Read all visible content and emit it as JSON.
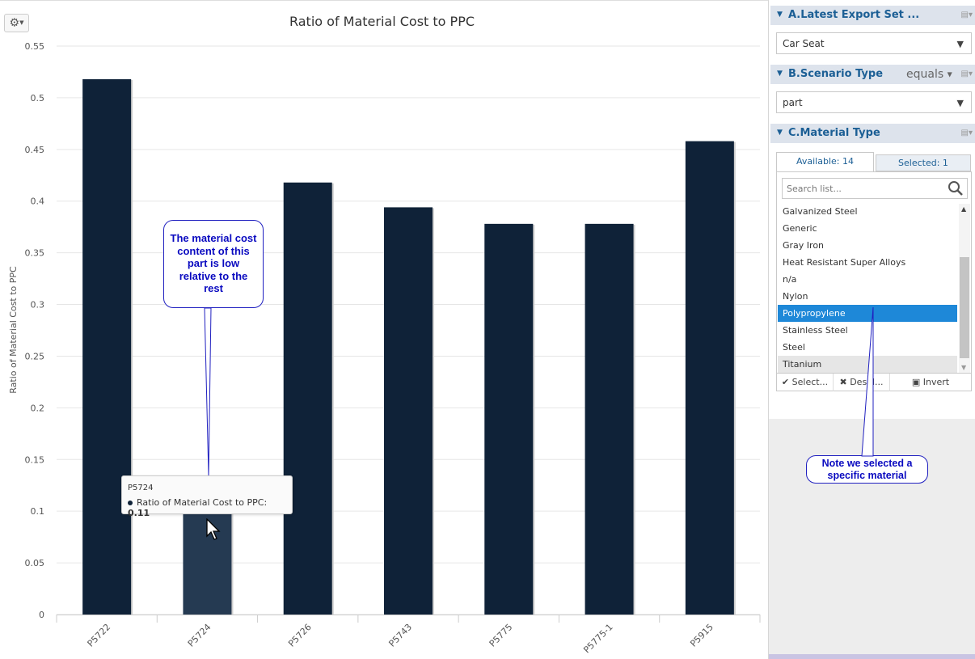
{
  "toolbar": {
    "gear_icon": "gear-icon"
  },
  "chart_data": {
    "type": "bar",
    "title": "Ratio of Material Cost to PPC",
    "ylabel": "Ratio of Material Cost to PPC",
    "xlabel": "",
    "categories": [
      "P5722",
      "P5724",
      "P5726",
      "P5743",
      "P5775",
      "P5775-1",
      "P5915"
    ],
    "values": [
      0.518,
      0.11,
      0.418,
      0.394,
      0.378,
      0.378,
      0.458
    ],
    "ylim": [
      0,
      0.55
    ],
    "yticks": [
      "0",
      "0.05",
      "0.1",
      "0.15",
      "0.2",
      "0.25",
      "0.3",
      "0.35",
      "0.4",
      "0.45",
      "0.5",
      "0.55"
    ],
    "highlighted_index": 1,
    "bar_color": "#0f2238",
    "highlight_color": "#253a52",
    "grid": true,
    "legend": "none"
  },
  "tooltip": {
    "category": "P5724",
    "series": "Ratio of Material Cost to PPC:",
    "value": "0.11"
  },
  "callouts": {
    "left": "The material cost content of this part is low relative to the rest",
    "right": "Note we selected a specific material"
  },
  "filters": {
    "a": {
      "title": "A.Latest Export Set ...",
      "value": "Car Seat"
    },
    "b": {
      "title": "B.Scenario Type",
      "operator": "equals",
      "value": "part"
    },
    "c": {
      "title": "C.Material Type",
      "tab_available": "Available: 14",
      "tab_selected": "Selected: 1",
      "search_placeholder": "Search list...",
      "items": [
        "Galvanized Steel",
        "Generic",
        "Gray Iron",
        "Heat Resistant Super Alloys",
        "n/a",
        "Nylon",
        "Polypropylene",
        "Stainless Steel",
        "Steel",
        "Titanium"
      ],
      "selected_item": "Polypropylene",
      "hover_item": "Titanium",
      "btn_select": "Select...",
      "btn_deselect": "Desel...",
      "btn_invert": "Invert"
    }
  },
  "colors": {
    "accent": "#1c5f95",
    "selection": "#1e88d8",
    "callout": "#2020c0"
  }
}
